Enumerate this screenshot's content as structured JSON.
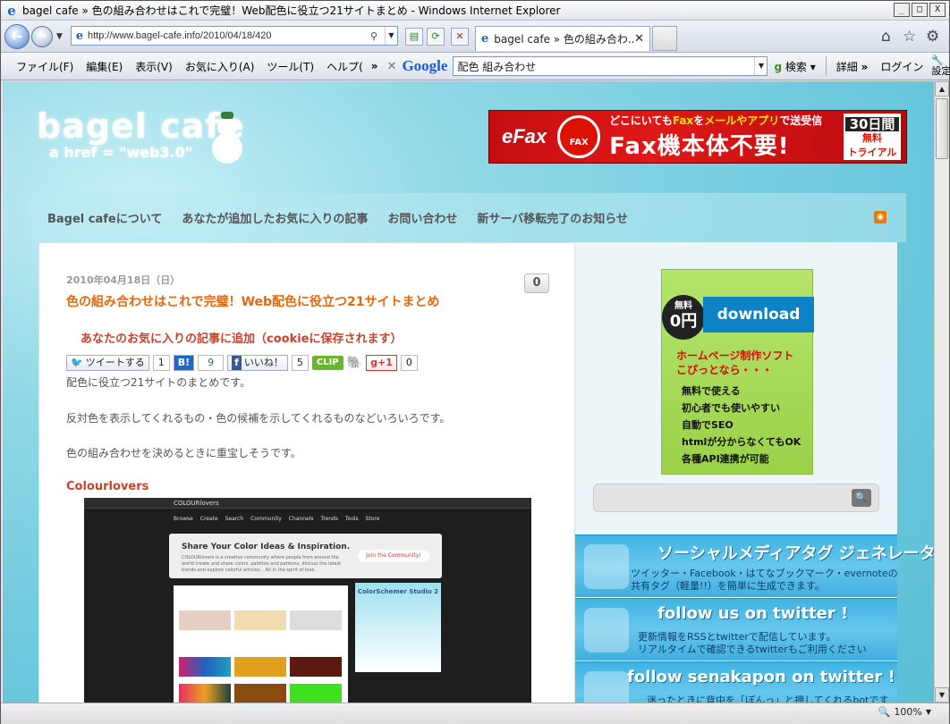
{
  "window": {
    "title": "bagel cafe » 色の組み合わせはこれで完璧！Web配色に役立つ21サイトまとめ - Windows Internet Explorer"
  },
  "address": {
    "url": "http://www.bagel-cafe.info/2010/04/18/420"
  },
  "tab": {
    "label": "bagel cafe » 色の組み合わ..."
  },
  "menu": {
    "items": [
      "ファイル(F)",
      "編集(E)",
      "表示(V)",
      "お気に入り(A)",
      "ツール(T)",
      "ヘルプ("
    ],
    "more": "»"
  },
  "google_toolbar": {
    "logo": "Google",
    "query": "配色 組み合わせ",
    "search_label": "検索",
    "detail_label": "詳細",
    "more": "»",
    "login_label": "ログイン",
    "settings_label": "設定"
  },
  "status": {
    "zoom": "100%"
  },
  "site": {
    "name": "bagel cafe",
    "tagline": "a href = \"web3.0\""
  },
  "ad_top": {
    "brand": "eFax",
    "icon_label": "FAX",
    "line1_pre": "どこにいても",
    "line1_fax": "Fax",
    "line1_mid": "を",
    "line1_hl": "メールやアプリ",
    "line1_post": "で送受信",
    "line2": "Fax機本体不要!",
    "trial_days": "30日間",
    "trial_free": "無料",
    "trial": "トライアル"
  },
  "nav": {
    "items": [
      "Bagel cafeについて",
      "あなたが追加したお気に入りの記事",
      "お問い合わせ",
      "新サーバ移転完了のお知らせ"
    ],
    "rss": "RSS"
  },
  "post": {
    "date": "2010年04月18日（日）",
    "comment_count": "0",
    "title": "色の組み合わせはこれで完璧！Web配色に役立つ21サイトまとめ",
    "add_fav": "あなたのお気に入りの記事に追加（cookieに保存されます）",
    "share": {
      "tweet": "ツイートする",
      "tweet_count": "1",
      "hatena": "B!",
      "hatena_count": "9",
      "like": "いいね！",
      "like_count": "5",
      "clip": "CLIP",
      "gplus": "+1",
      "gplus_count": "0"
    },
    "para1": "配色に役立つ21サイトのまとめです。",
    "para2": "反対色を表示してくれるもの・色の候補を示してくれるものなどいろいろです。",
    "para3": "色の組み合わせを決めるときに重宝しそうです。",
    "section": "Colourlovers",
    "screenshot": {
      "site": "COLOURlovers",
      "menu": "Browse Create Search Community Channels Trends Tools Store",
      "headline": "Share Your Color Ideas & Inspiration.",
      "desc": "COLOURlovers is a creative community where people from around the world create and share colors, palettes and patterns, discuss the latest trends and explore colorful articles... All in the spirit of love.",
      "join": "Join the Community!",
      "studio": "ColorSchemer Studio 2"
    }
  },
  "sidebar": {
    "dl_ad": {
      "free": "無料",
      "zero": "0円",
      "banner": "download",
      "headline": "ホームページ制作ソフト\nこぴっとなら・・・",
      "points": [
        "無料で使える",
        "初心者でも使いやすい",
        "自動でSEO",
        "htmlが分からなくてもOK",
        "各種API連携が可能"
      ]
    },
    "search_button": "🔍",
    "banners": [
      {
        "title": "ソーシャルメディアタグ ジェネレータ",
        "desc": "ツイッター・Facebook・はてなブックマーク・evernoteの\n共有タグ（軽量!!）を簡単に生成できます。"
      },
      {
        "title": "follow us on twitter !",
        "desc": "更新情報をRSSとtwitterで配信しています。\nリアルタイムで確認できるtwitterもご利用ください"
      },
      {
        "title": "follow senakapon on twitter !",
        "desc": "迷ったときに背中を「ぽんっ」と押してくれるbotです"
      }
    ]
  }
}
